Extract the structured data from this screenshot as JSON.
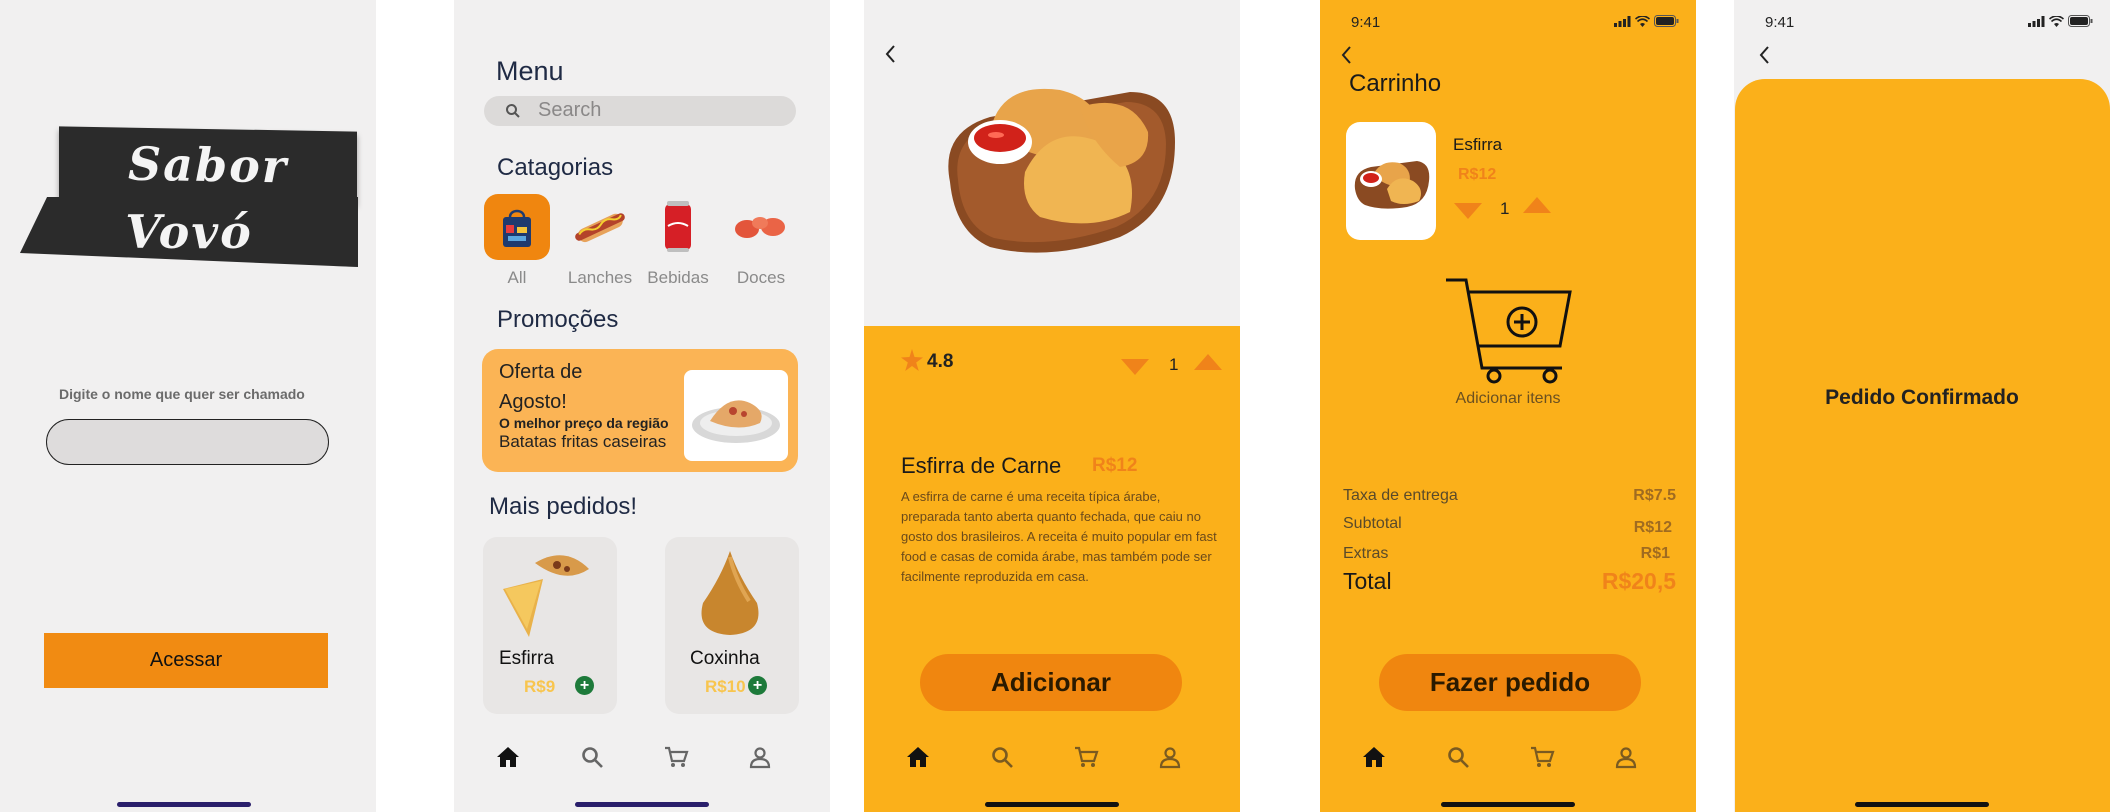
{
  "login": {
    "logo_line1": "Sabor",
    "logo_line2": "Vovó",
    "name_label": "Digite o nome que quer ser chamado",
    "name_value": "",
    "access_button": "Acessar"
  },
  "menu": {
    "title": "Menu",
    "search_placeholder": "Search",
    "categories_title": "Catagorias",
    "categories": [
      {
        "label": "All",
        "icon": "shopping-bag-icon",
        "selected": true
      },
      {
        "label": "Lanches",
        "icon": "hot-dog-icon",
        "selected": false
      },
      {
        "label": "Bebidas",
        "icon": "soda-can-icon",
        "selected": false
      },
      {
        "label": "Doces",
        "icon": "candy-icon",
        "selected": false
      }
    ],
    "promotions_title": "Promoções",
    "promo": {
      "headline": "Oferta de Agosto!",
      "subtitle": "O melhor preço da região",
      "description": "Batatas fritas caseiras"
    },
    "popular_title": "Mais pedidos!",
    "popular_items": [
      {
        "name": "Esfirra",
        "price": "R$9"
      },
      {
        "name": "Coxinha",
        "price": "R$10"
      }
    ]
  },
  "product": {
    "rating": "4.8",
    "quantity": "1",
    "name": "Esfirra de Carne",
    "price": "R$12",
    "description": "A esfirra de carne é uma receita típica árabe, preparada tanto aberta quanto fechada, que caiu no gosto dos brasileiros. A receita é muito popular em fast food e casas de comida árabe, mas também pode ser facilmente reproduzida em casa.",
    "add_button": "Adicionar"
  },
  "cart": {
    "status_time": "9:41",
    "title": "Carrinho",
    "item_name": "Esfirra",
    "item_price": "R$12",
    "item_quantity": "1",
    "add_items_label": "Adicionar itens",
    "delivery_fee_label": "Taxa de entrega",
    "delivery_fee_value": "R$7.5",
    "subtotal_label": "Subtotal",
    "subtotal_value": "R$12",
    "extras_label": "Extras",
    "extras_value": "R$1",
    "total_label": "Total",
    "total_value": "R$20,5",
    "order_button": "Fazer pedido"
  },
  "confirmation": {
    "status_time": "9:41",
    "message": "Pedido Confirmado"
  },
  "tabbar": [
    "home-icon",
    "search-icon",
    "cart-icon",
    "profile-icon"
  ],
  "colors": {
    "orange": "#fbb01a",
    "button_orange": "#f0860f",
    "price_orange": "#f0831a",
    "background": "#f1f0f0"
  }
}
